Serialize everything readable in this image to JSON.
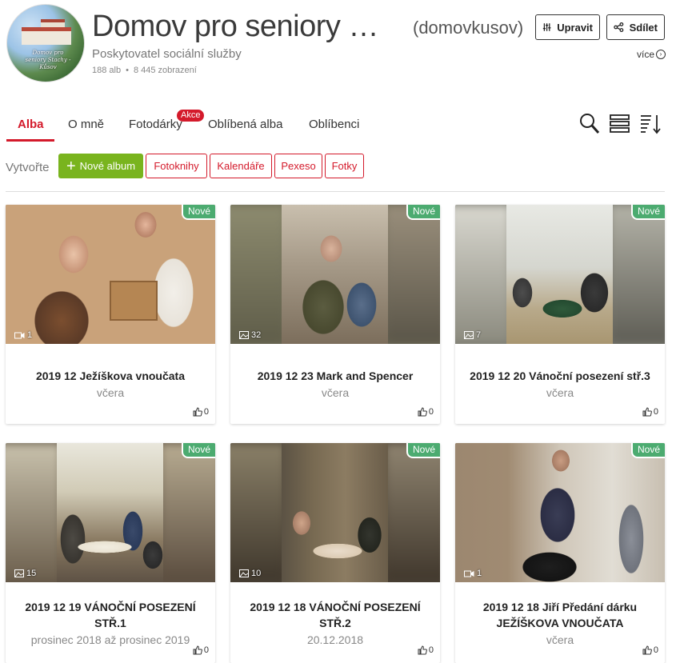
{
  "header": {
    "logo_text": "Domov pro seniory Stachy - Kůsov",
    "title": "Domov pro seniory Stac...",
    "username": "(domovkusov)",
    "subtitle": "Poskytovatel sociální služby",
    "albums_count": "188 alb",
    "views": "8 445 zobrazení",
    "edit_label": "Upravit",
    "share_label": "Sdílet",
    "more_label": "více"
  },
  "tabs": {
    "items": [
      "Alba",
      "O mně",
      "Fotodárky",
      "Oblíbená alba",
      "Oblíbenci"
    ],
    "active": "Alba",
    "badge": "Akce"
  },
  "toolbar_icons": [
    "search-icon",
    "list-view-icon",
    "sort-icon"
  ],
  "create": {
    "label": "Vytvořte",
    "new_album": "Nové album",
    "buttons": [
      "Fotoknihy",
      "Kalendáře",
      "Pexeso",
      "Fotky"
    ]
  },
  "albums": [
    {
      "badge": "Nové",
      "count": "1",
      "count_icon": "video-icon",
      "title": "2019 12 Ježíškova vnoučata",
      "date": "včera",
      "likes": "0"
    },
    {
      "badge": "Nové",
      "count": "32",
      "count_icon": "image-icon",
      "title": "2019 12 23 Mark and Spencer",
      "date": "včera",
      "likes": "0"
    },
    {
      "badge": "Nové",
      "count": "7",
      "count_icon": "image-icon",
      "title": "2019 12 20 Vánoční posezení stř.3",
      "date": "včera",
      "likes": "0"
    },
    {
      "badge": "Nové",
      "count": "15",
      "count_icon": "image-icon",
      "title": "2019 12 19 VÁNOČNÍ POSEZENÍ STŘ.1",
      "date": "prosinec 2018 až prosinec 2019",
      "likes": "0"
    },
    {
      "badge": "Nové",
      "count": "10",
      "count_icon": "image-icon",
      "title": "2019 12 18 VÁNOČNÍ POSEZENÍ STŘ.2",
      "date": "20.12.2018",
      "likes": "0"
    },
    {
      "badge": "Nové",
      "count": "1",
      "count_icon": "video-icon",
      "title": "2019 12 18 Jiří Předání dárku JEŽÍŠKOVA VNOUČATA",
      "date": "včera",
      "likes": "0"
    }
  ],
  "colors": {
    "accent": "#d41a2b",
    "new_album_green": "#79b41e",
    "new_badge_green": "#4cab70"
  }
}
